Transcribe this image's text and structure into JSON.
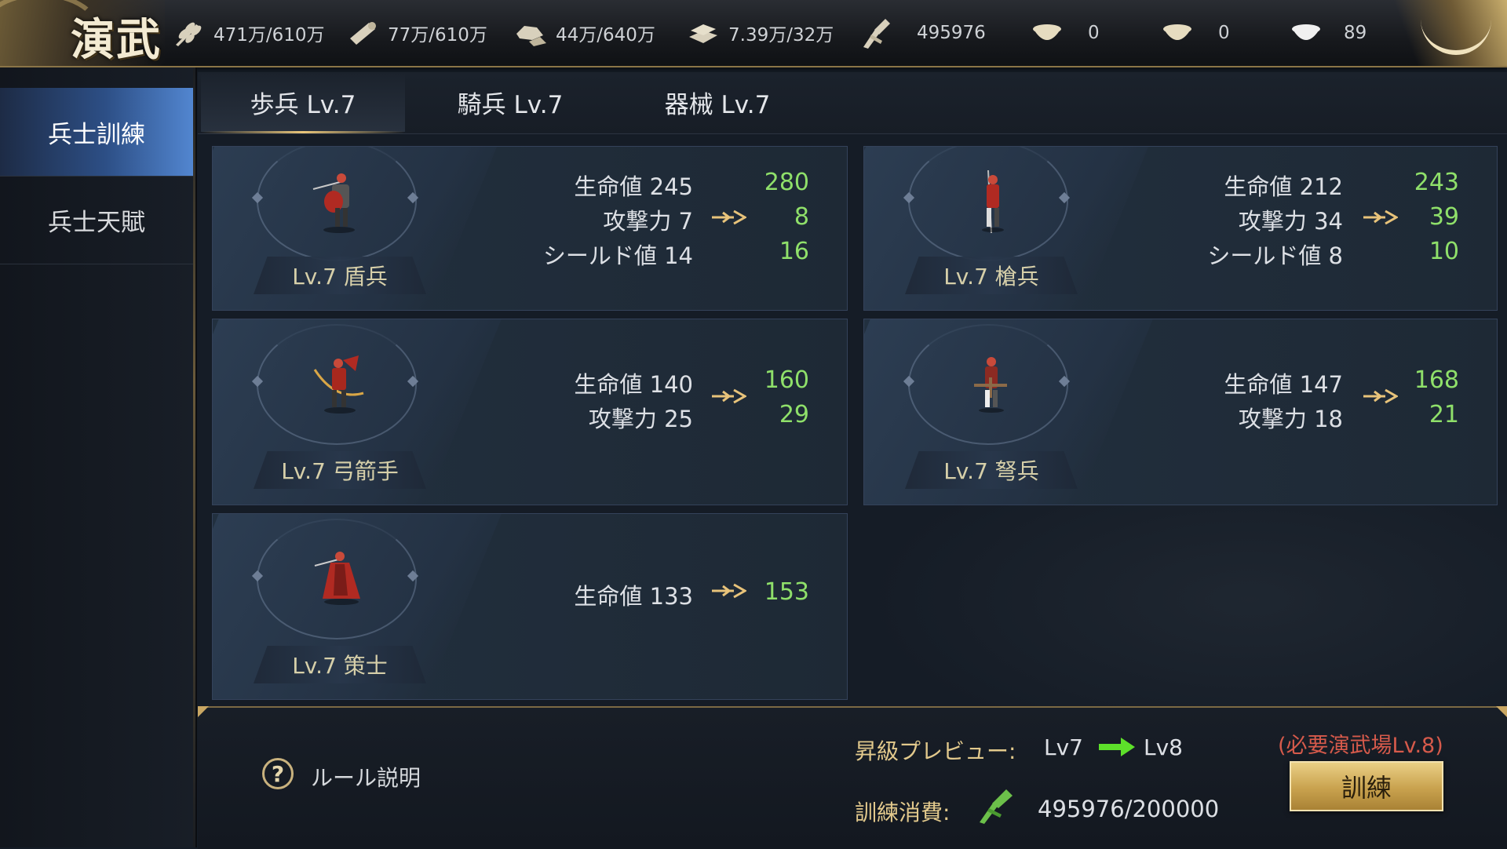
{
  "header": {
    "logo": "演武",
    "resources": [
      {
        "icon": "wheat-icon",
        "value": "471万/610万"
      },
      {
        "icon": "wood-icon",
        "value": "77万/610万"
      },
      {
        "icon": "stone-icon",
        "value": "44万/640万"
      },
      {
        "icon": "iron-ingot-icon",
        "value": "7.39万/32万"
      },
      {
        "icon": "training-token-icon",
        "value": "495976"
      },
      {
        "icon": "gold-bowl-icon",
        "value": "0"
      },
      {
        "icon": "gold-bowl-icon",
        "value": "0"
      },
      {
        "icon": "silver-bowl-icon",
        "value": "89"
      }
    ]
  },
  "sidebar": {
    "items": [
      {
        "label": "兵士訓練",
        "active": true
      },
      {
        "label": "兵士天賦",
        "active": false
      }
    ]
  },
  "tabs": [
    {
      "label": "歩兵 Lv.7",
      "active": true
    },
    {
      "label": "騎兵 Lv.7",
      "active": false
    },
    {
      "label": "器械 Lv.7",
      "active": false
    }
  ],
  "units": [
    {
      "name": "Lv.7 盾兵",
      "stats": [
        {
          "label": "生命値 245",
          "new": "280"
        },
        {
          "label": "攻撃力  7",
          "new": "8"
        },
        {
          "label": "シールド値  14",
          "new": "16"
        }
      ]
    },
    {
      "name": "Lv.7 槍兵",
      "stats": [
        {
          "label": "生命値 212",
          "new": "243"
        },
        {
          "label": "攻撃力 34",
          "new": "39"
        },
        {
          "label": "シールド値  8",
          "new": "10"
        }
      ]
    },
    {
      "name": "Lv.7 弓箭手",
      "stats": [
        {
          "label": "生命値 140",
          "new": "160"
        },
        {
          "label": "攻撃力 25",
          "new": "29"
        }
      ]
    },
    {
      "name": "Lv.7 弩兵",
      "stats": [
        {
          "label": "生命値 147",
          "new": "168"
        },
        {
          "label": "攻撃力 18",
          "new": "21"
        }
      ]
    },
    {
      "name": "Lv.7 策士",
      "stats": [
        {
          "label": "生命値 133",
          "new": "153"
        }
      ]
    }
  ],
  "footer": {
    "rules_label": "ルール説明",
    "help_symbol": "?",
    "preview_label": "昇級プレビュー:",
    "level_from": "Lv7",
    "level_to": "Lv8",
    "cost_label": "訓練消費:",
    "cost_value": "495976/200000",
    "requirement": "(必要演武場Lv.8)",
    "train_button": "訓練"
  },
  "colors": {
    "accent_gold": "#e2c98c",
    "upgrade_green": "#8fe06a",
    "requirement_red": "#d65a4b",
    "active_tab_blue": "#3f6fb8"
  }
}
